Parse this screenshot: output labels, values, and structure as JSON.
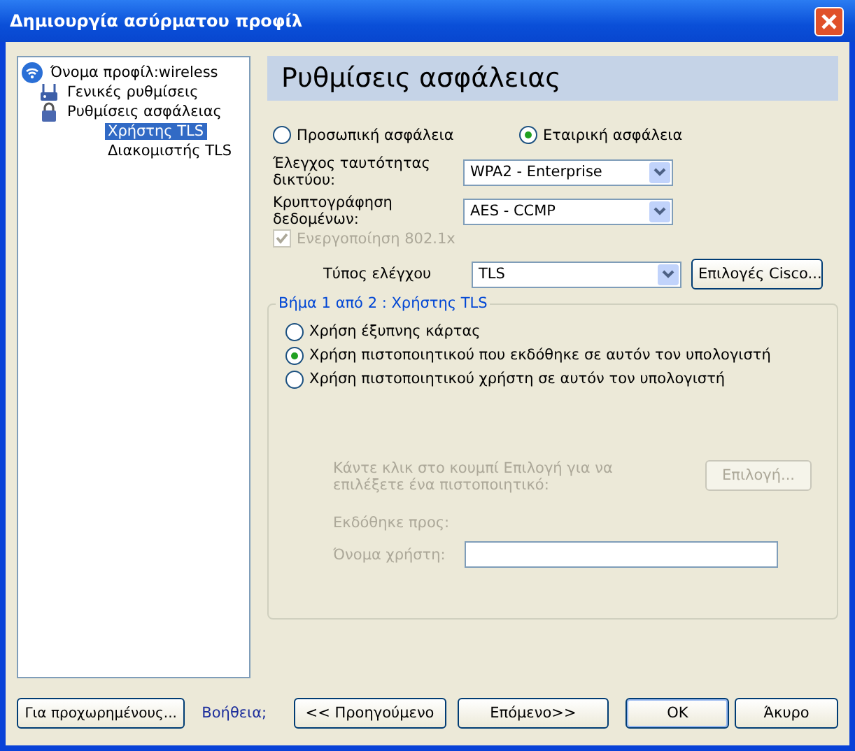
{
  "window": {
    "title": "Δημιουργία ασύρματου προφίλ"
  },
  "tree": [
    {
      "label": "Όνομα προφίλ:wireless",
      "selected": false,
      "children": [
        {
          "label": "Γενικές ρυθμίσεις",
          "selected": false
        },
        {
          "label": "Ρυθμίσεις ασφάλειας",
          "selected": false,
          "children": [
            {
              "label": "Χρήστης TLS",
              "selected": true
            },
            {
              "label": "Διακομιστής TLS",
              "selected": false
            }
          ]
        }
      ]
    }
  ],
  "header": "Ρυθμίσεις ασφάλειας",
  "security_modes": [
    {
      "label": "Προσωπική ασφάλεια",
      "selected": false
    },
    {
      "label": "Εταιρική ασφάλεια",
      "selected": true
    }
  ],
  "selects": [
    {
      "label": "Έλεγχος ταυτότητας δικτύου:",
      "value": "WPA2 - Enterprise"
    },
    {
      "label": "Κρυπτογράφηση δεδομένων:",
      "value": "AES - CCMP"
    }
  ],
  "enable_8021x": {
    "label": "Ενεργοποίηση 802.1x",
    "checked": true,
    "disabled": true
  },
  "auth_type": {
    "label": "Τύπος ελέγχου",
    "value": "TLS",
    "button": "Επιλογές Cisco..."
  },
  "group": {
    "title": "Βήμα 1 από 2 : Χρήστης TLS",
    "options": [
      {
        "label": "Χρήση έξυπνης κάρτας",
        "selected": false
      },
      {
        "label": "Χρήση πιστοποιητικού που εκδόθηκε σε αυτόν τον υπολογιστή",
        "selected": true
      },
      {
        "label": "Χρήση πιστοποιητικού χρήστη σε αυτόν τον υπολογιστή",
        "selected": false
      }
    ],
    "hint": "Κάντε κλικ στο κουμπί Επιλογή για να επιλέξετε ένα πιστοποιητικό:",
    "select_button": "Επιλογή...",
    "issued_to": "Εκδόθηκε προς:",
    "username_label": "Όνομα χρήστη:"
  },
  "footer": {
    "advanced": "Για προχωρημένους...",
    "help": "Βοήθεια;",
    "back": "<< Προηγούμενο",
    "next": "Επόμενο>>",
    "ok": "OK",
    "cancel": "Άκυρο"
  }
}
